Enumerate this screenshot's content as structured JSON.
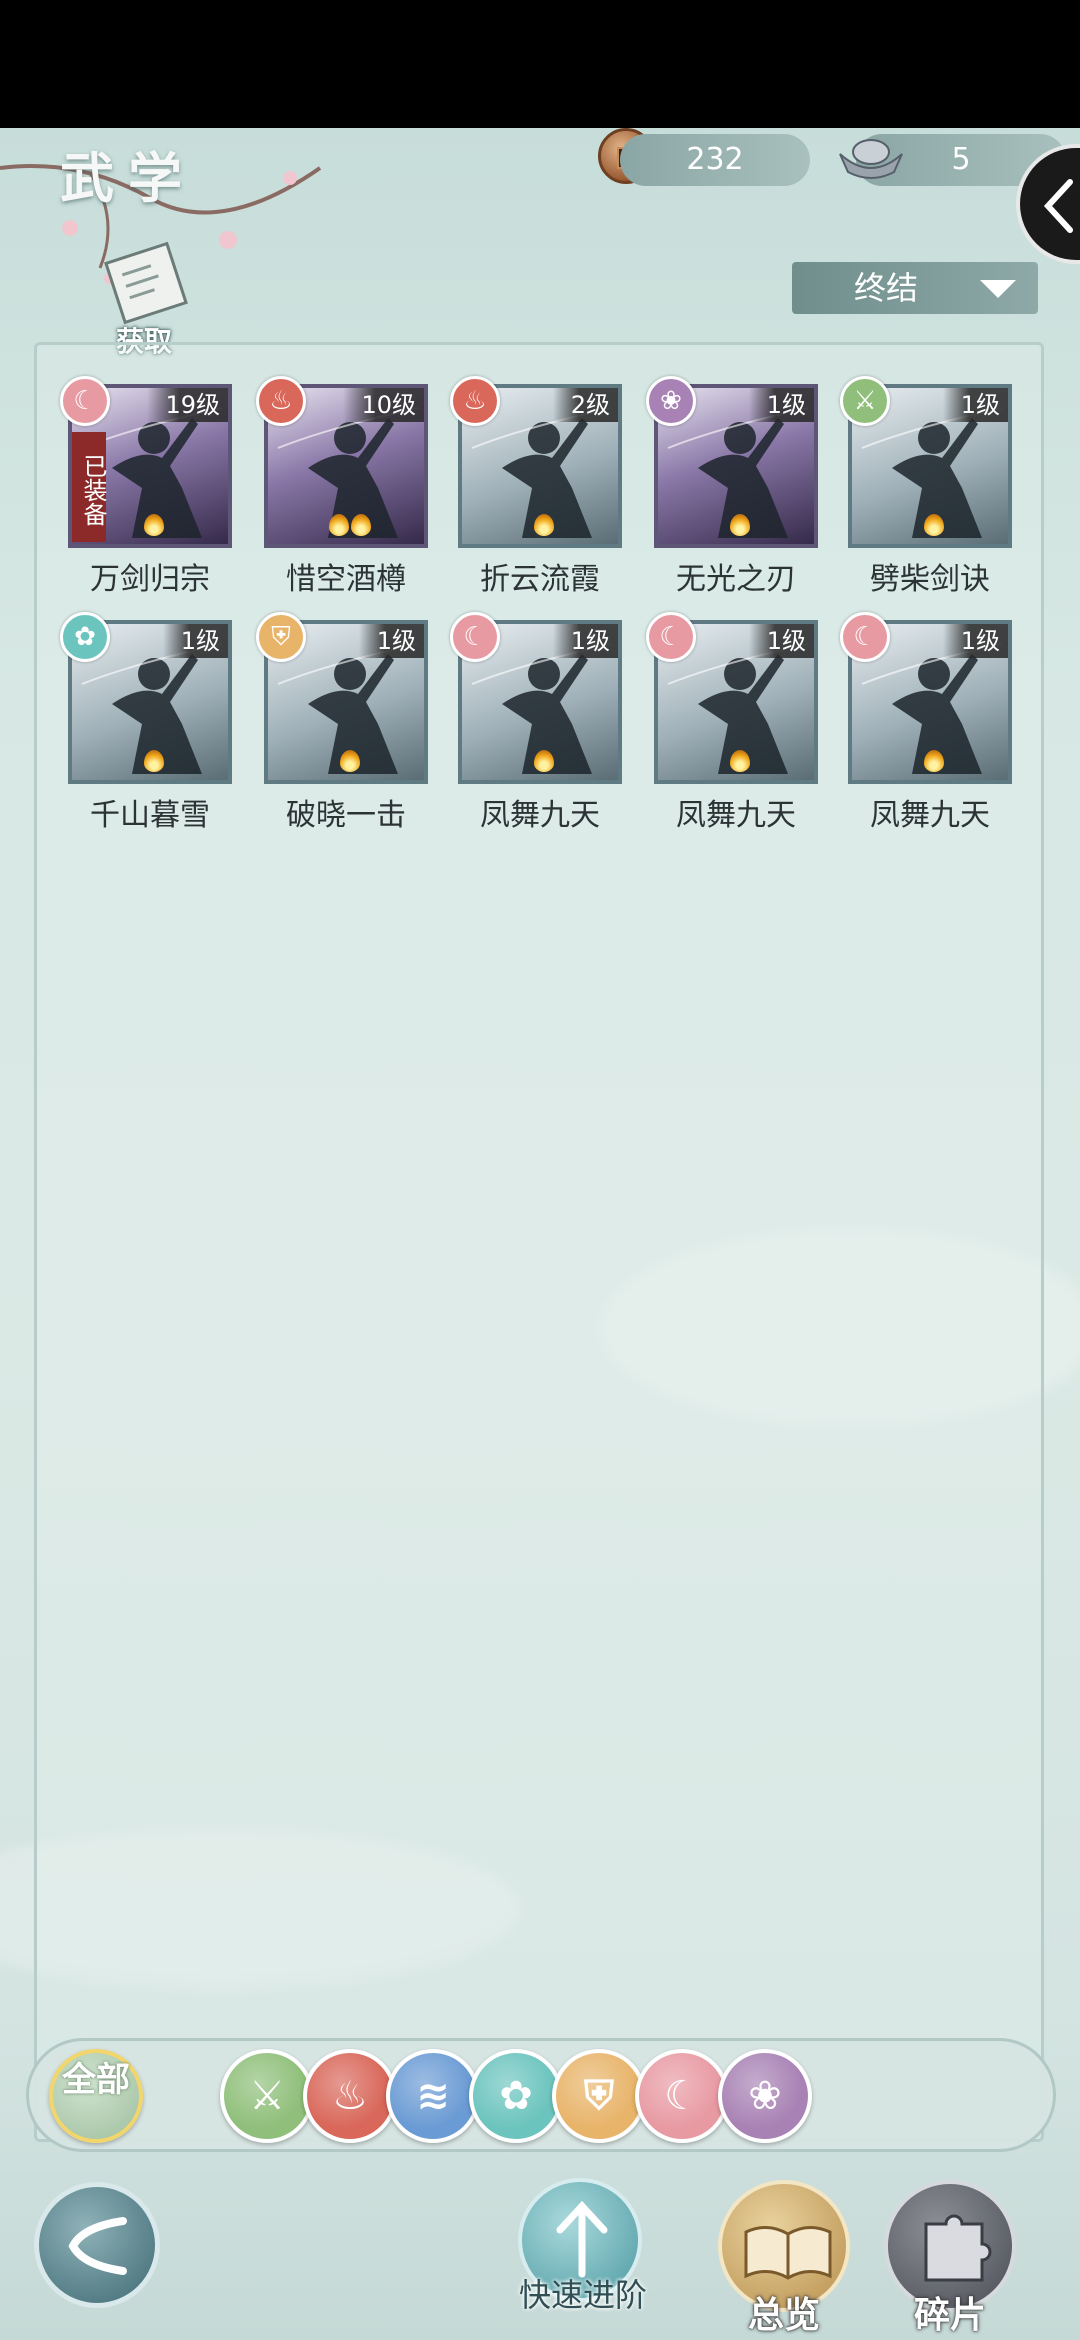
{
  "header": {
    "title": "武学",
    "currency_copper": "232",
    "currency_silver": "5",
    "obtain_label": "获取",
    "filter_selected": "终结"
  },
  "equipped_label": "已装备",
  "cards": [
    {
      "name": "万剑归宗",
      "level": "19级",
      "element": "crescent-icon",
      "element_color": "#e89aa3",
      "flames": 1,
      "equipped": true
    },
    {
      "name": "惜空酒樽",
      "level": "10级",
      "element": "fire-icon",
      "element_color": "#d9675a",
      "flames": 2,
      "equipped": false
    },
    {
      "name": "折云流霞",
      "level": "2级",
      "element": "fire-icon",
      "element_color": "#d9675a",
      "flames": 1,
      "equipped": false
    },
    {
      "name": "无光之刃",
      "level": "1级",
      "element": "rose-icon",
      "element_color": "#a882b4",
      "flames": 1,
      "equipped": false
    },
    {
      "name": "劈柴剑诀",
      "level": "1级",
      "element": "sword-icon",
      "element_color": "#8fbf7a",
      "flames": 1,
      "equipped": false
    },
    {
      "name": "千山暮雪",
      "level": "1级",
      "element": "butterfly-icon",
      "element_color": "#6cc4be",
      "flames": 1,
      "equipped": false
    },
    {
      "name": "破晓一击",
      "level": "1级",
      "element": "shield-icon",
      "element_color": "#e8b46a",
      "flames": 1,
      "equipped": false
    },
    {
      "name": "凤舞九天",
      "level": "1级",
      "element": "crescent-icon",
      "element_color": "#e89aa3",
      "flames": 1,
      "equipped": false
    },
    {
      "name": "凤舞九天",
      "level": "1级",
      "element": "crescent-icon",
      "element_color": "#e89aa3",
      "flames": 1,
      "equipped": false
    },
    {
      "name": "凤舞九天",
      "level": "1级",
      "element": "crescent-icon",
      "element_color": "#e89aa3",
      "flames": 1,
      "equipped": false
    }
  ],
  "categories": {
    "all_label": "全部",
    "items": [
      {
        "icon": "sword-icon",
        "color": "#8fbf7a"
      },
      {
        "icon": "fire-icon",
        "color": "#d9675a"
      },
      {
        "icon": "wave-icon",
        "color": "#6b9bd4"
      },
      {
        "icon": "butterfly-icon",
        "color": "#6cc4be"
      },
      {
        "icon": "shield-icon",
        "color": "#e8b46a"
      },
      {
        "icon": "crescent-icon",
        "color": "#e89aa3"
      },
      {
        "icon": "rose-icon",
        "color": "#a882b4"
      }
    ]
  },
  "nav": {
    "quick_advance": "快速进阶",
    "overview": "总览",
    "fragments": "碎片"
  }
}
